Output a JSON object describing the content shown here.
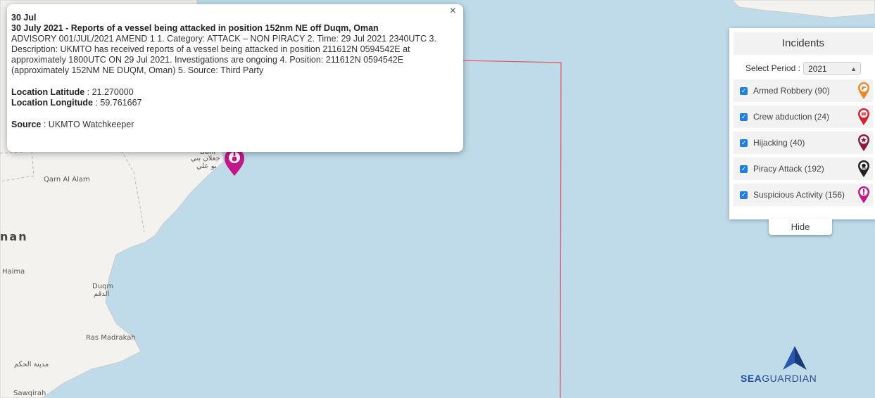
{
  "popup": {
    "date": "30 Jul",
    "headline": "30 July 2021 - Reports of a vessel being attacked in position 152nm NE off Duqm, Oman",
    "body": "ADVISORY 001/JUL/2021 AMEND 1 1. Category: ATTACK – NON PIRACY 2. Time: 29 Jul 2021 2340UTC 3. Description: UKMTO has received reports of a vessel being attacked in position 211612N 0594542E at approximately 1800UTC ON 29 Jul 2021. Investigations are ongoing 4. Position: 211612N 0594542E (approximately 152NM NE DUQM, Oman) 5. Source: Third Party",
    "lat_label": "Location Latitude",
    "lat_value": " : 21.270000",
    "lon_label": "Location Longitude",
    "lon_value": " : 59.761667",
    "source_label": "Source",
    "source_value": " : UKMTO Watchkeeper",
    "close_icon": "×"
  },
  "map": {
    "places": {
      "oman": "nan",
      "qarn_al_alam": "Qarn Al Alam",
      "haima": "Haima",
      "duqm": "Duqm",
      "duqm_ar": "الدقم",
      "ras_madrakah": "Ras Madrakah",
      "madinat_al_hakm": "مدينة الحكم",
      "sawqirah": "Sawqirah",
      "jaalan_ar_1": "جعلان بني",
      "jaalan_ar_2": "بو علي",
      "jaalan_partial": "Bani"
    },
    "incident_marker_color": "#c2188a",
    "boundary_color": "#e05a6a"
  },
  "panel": {
    "title": "Incidents",
    "period_label": "Select Period :",
    "period_value": "2021",
    "categories": [
      {
        "label": "Armed Robbery (90)",
        "checked": true,
        "icon": "armed-robbery-icon",
        "color": "#e8892c"
      },
      {
        "label": "Crew abduction (24)",
        "checked": true,
        "icon": "crew-abduction-icon",
        "color": "#d8202e"
      },
      {
        "label": "Hijacking (40)",
        "checked": true,
        "icon": "hijacking-icon",
        "color": "#8a1c3a"
      },
      {
        "label": "Piracy Attack (192)",
        "checked": true,
        "icon": "piracy-attack-icon",
        "color": "#222222"
      },
      {
        "label": "Suspicious Activity (156)",
        "checked": true,
        "icon": "suspicious-activity-icon",
        "color": "#c2188a"
      }
    ],
    "hide_label": "Hide"
  },
  "logo": {
    "part1": "SEA",
    "part2": "GUARDIAN",
    "color1": "#1f4f9e",
    "color2": "#2a4a8a"
  }
}
